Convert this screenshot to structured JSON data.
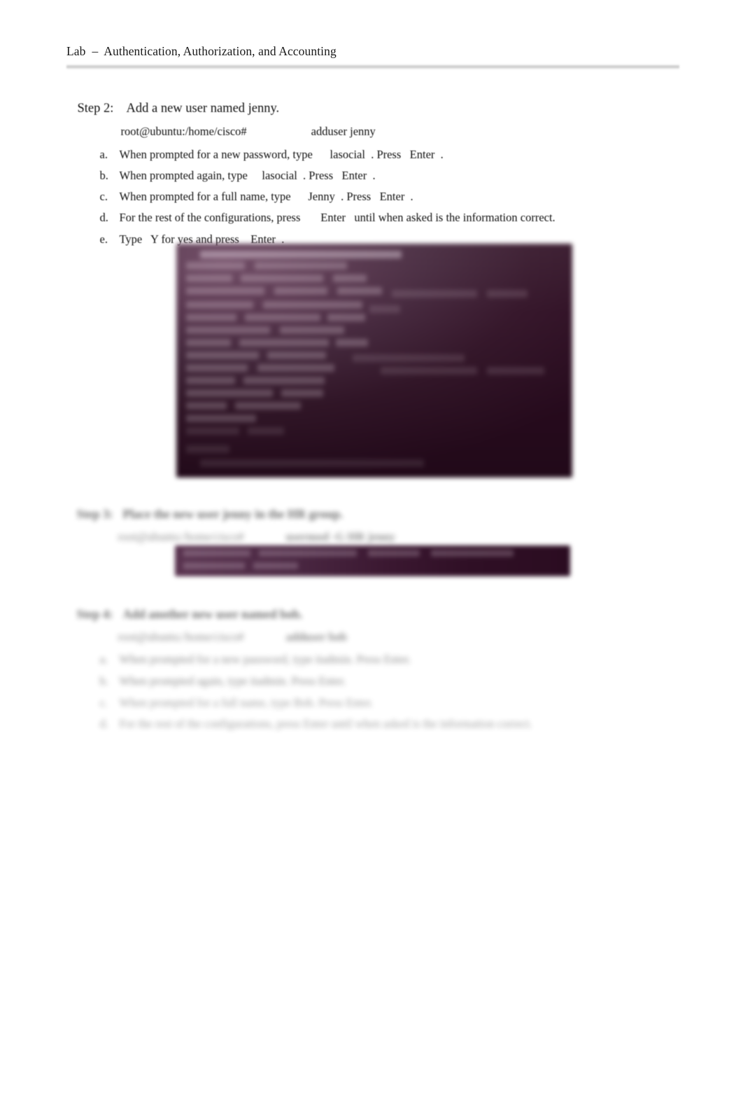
{
  "document": {
    "header": "Lab  –  Authentication, Authorization, and Accounting"
  },
  "step2": {
    "label": "Step 2:",
    "title": "Add a new user named jenny.",
    "command_prompt": "root@ubuntu:/home/cisco#",
    "command": "adduser jenny",
    "items": [
      {
        "marker": "a.",
        "text": "When prompted for a new password, type      lasocial  . Press   Enter  ."
      },
      {
        "marker": "b.",
        "text": "When prompted again, type     lasocial  . Press   Enter  ."
      },
      {
        "marker": "c.",
        "text": "When prompted for a full name, type      Jenny  . Press   Enter  ."
      },
      {
        "marker": "d.",
        "text": "For the rest of the configurations, press       Enter   until when asked is the information correct."
      },
      {
        "marker": "e.",
        "text": "Type   Y for yes and press    Enter  ."
      }
    ],
    "screenshot_caption": "terminal output of adduser jenny"
  },
  "step3": {
    "label": "Step 3:",
    "title": "Place the new user jenny in the HR group.",
    "command_prompt": "root@ubuntu:/home/cisco#",
    "command": "usermod -G HR jenny",
    "screenshot_caption": "terminal output of usermod command"
  },
  "step4": {
    "label": "Step 4:",
    "title": "Add another new user named bob.",
    "command_prompt": "root@ubuntu:/home/cisco#",
    "command": "adduser bob",
    "items": [
      {
        "marker": "a.",
        "text": "When prompted for a new password, type itadmin. Press Enter."
      },
      {
        "marker": "b.",
        "text": "When prompted again, type itadmin. Press Enter."
      },
      {
        "marker": "c.",
        "text": "When prompted for a full name, type Bob. Press Enter."
      },
      {
        "marker": "d.",
        "text": "For the rest of the configurations, press Enter until when asked is the information correct."
      }
    ]
  },
  "colors": {
    "terminal_background_dark": "#2d0d22",
    "terminal_background_light": "#5c3a52",
    "header_rule": "#cccccc",
    "page_background": "#ffffff",
    "body_text": "#111111"
  }
}
